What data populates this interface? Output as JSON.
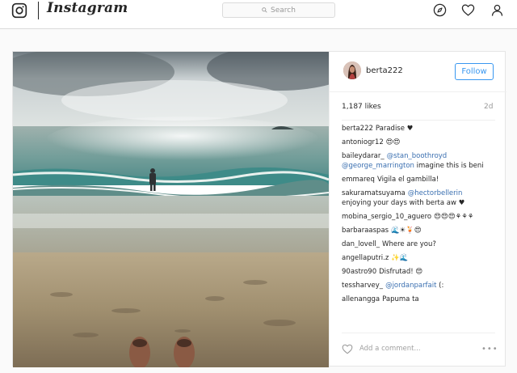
{
  "header": {
    "brand": "Instagram",
    "search_placeholder": "Search"
  },
  "post": {
    "author": "berta222",
    "follow_label": "Follow",
    "likes": "1,187 likes",
    "age": "2d",
    "comments": [
      {
        "user": "berta222",
        "text": "Paradise ♥"
      },
      {
        "user": "antoniogr12",
        "text": "😍😍"
      },
      {
        "user": "baileydarar_",
        "mention": "@stan_boothroyd",
        "line2_mention": "@george_marrington",
        "line2_text": " imagine this is beni"
      },
      {
        "user": "emmareq",
        "text": "Vigila el gambilla!"
      },
      {
        "user": "sakuramatsuyama",
        "mention": "@hectorbellerin",
        "line2_text": "enjoying your days with berta aw ♥"
      },
      {
        "user": "mobina_sergio_10_aguero",
        "text": "😍😍😍⚘⚘⚘"
      },
      {
        "user": "barbaraaspas",
        "text": "🌊☀🍹😍"
      },
      {
        "user": "dan_lovell_",
        "text": "Where are you?"
      },
      {
        "user": "angellaputri.z",
        "text": "✨🌊"
      },
      {
        "user": "90astro90",
        "text": "Disfrutad! 😍"
      },
      {
        "user": "tessharvey_",
        "mention": "@jordanparfait",
        "text": " (:"
      },
      {
        "user": "allenangga",
        "text": "Papuma ta"
      }
    ],
    "add_comment_placeholder": "Add a comment...",
    "more_label": "•••"
  },
  "icons": {
    "logo": "instagram-camera-icon",
    "search": "search-icon",
    "explore": "compass-icon",
    "activity": "heart-icon",
    "profile": "person-icon",
    "like": "heart-outline-icon"
  },
  "colors": {
    "accent": "#3897f0",
    "mention": "#3a6fb0",
    "border": "#dbdbdb"
  }
}
